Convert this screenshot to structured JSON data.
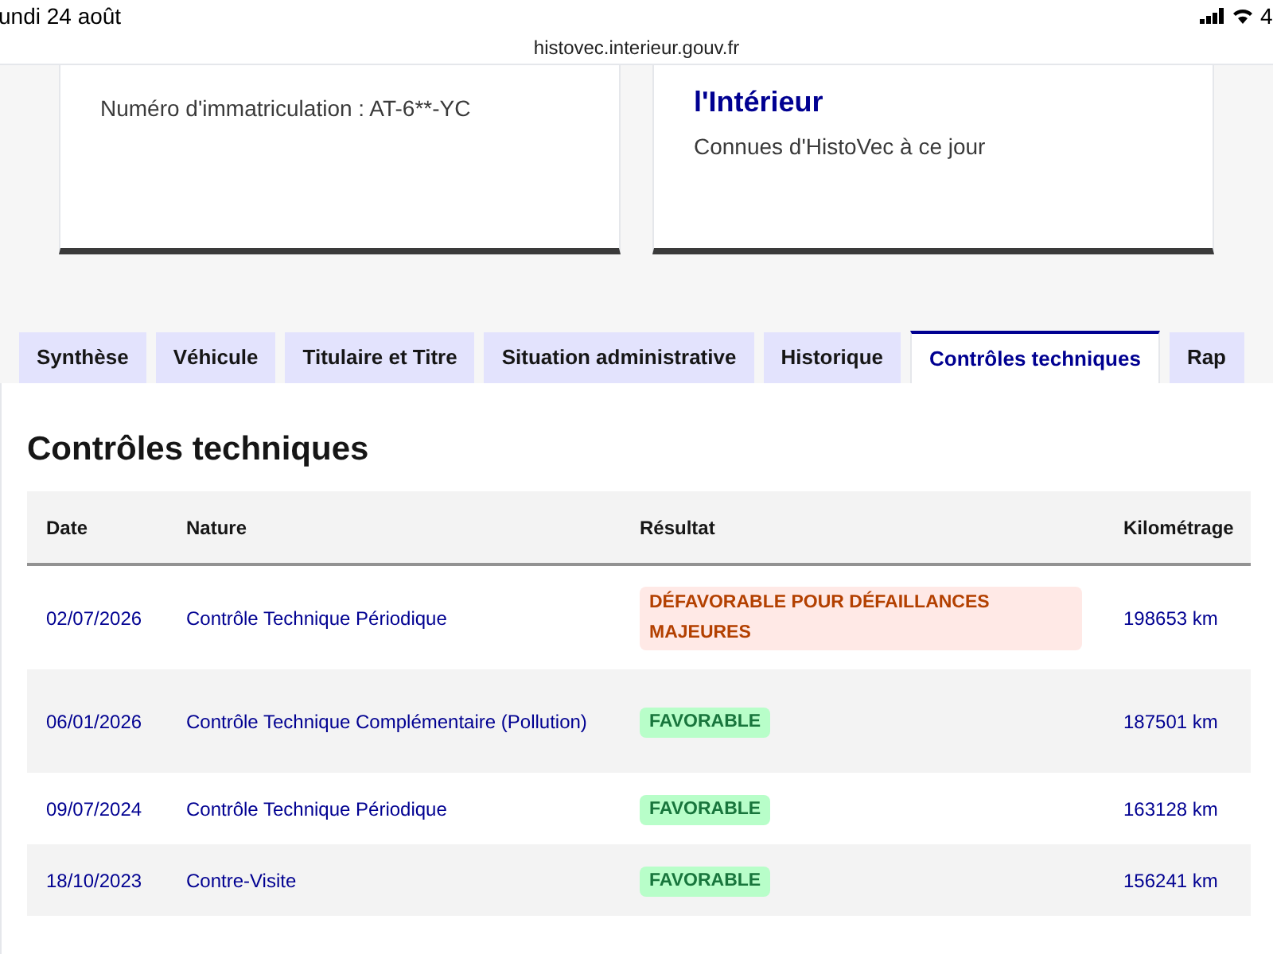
{
  "status_bar": {
    "date": "undi 24 août",
    "battery": "4"
  },
  "address_bar": {
    "url": "histovec.interieur.gouv.fr"
  },
  "cards": [
    {
      "text": "Numéro d'immatriculation : AT-6**-YC"
    },
    {
      "title_lines": [
        "l'Intérieur"
      ],
      "text": "Connues d'HistoVec à ce jour"
    }
  ],
  "tabs": [
    {
      "label": "Synthèse",
      "selected": false
    },
    {
      "label": "Véhicule",
      "selected": false
    },
    {
      "label": "Titulaire et Titre",
      "selected": false
    },
    {
      "label": "Situation administrative",
      "selected": false
    },
    {
      "label": "Historique",
      "selected": false
    },
    {
      "label": "Contrôles techniques",
      "selected": true
    },
    {
      "label": "Rap",
      "selected": false
    }
  ],
  "section_title": "Contrôles techniques",
  "table": {
    "columns": [
      "Date",
      "Nature",
      "Résultat",
      "Kilométrage"
    ],
    "rows": [
      {
        "date": "02/07/2026",
        "nature": "Contrôle Technique Périodique",
        "result": "DÉFAVORABLE POUR DÉFAILLANCES MAJEURES",
        "kind": "unfavorable",
        "km": "198653 km"
      },
      {
        "date": "06/01/2026",
        "nature": "Contrôle Technique Complémentaire (Pollution)",
        "result": "FAVORABLE",
        "kind": "favorable",
        "km": "187501 km"
      },
      {
        "date": "09/07/2024",
        "nature": "Contrôle Technique Périodique",
        "result": "FAVORABLE",
        "kind": "favorable",
        "km": "163128 km"
      },
      {
        "date": "18/10/2023",
        "nature": "Contre-Visite",
        "result": "FAVORABLE",
        "kind": "favorable",
        "km": "156241 km"
      }
    ]
  }
}
